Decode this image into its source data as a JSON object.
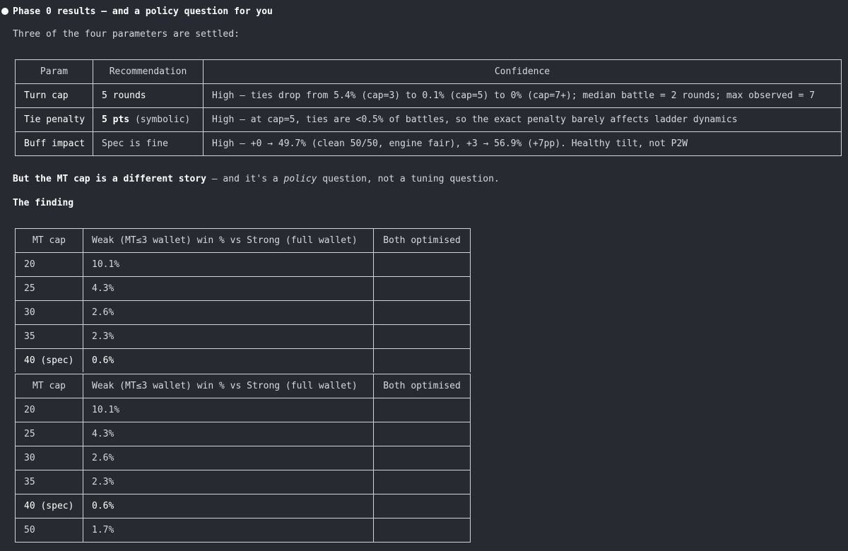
{
  "heading": "Phase 0 results — and a policy question for you",
  "intro": "Three of the four parameters are settled:",
  "params_table": {
    "headers": [
      "Param",
      "Recommendation",
      "Confidence"
    ],
    "rows": [
      {
        "param": "Turn cap",
        "rec": "5 rounds",
        "conf": "High — ties drop from 5.4% (cap=3) to 0.1% (cap=5) to 0% (cap=7+); median battle = 2 rounds; max observed = 7"
      },
      {
        "param": "Tie penalty",
        "rec": "5 pts (symbolic)",
        "conf": "High — at cap=5, ties are <0.5% of battles, so the exact penalty barely affects ladder dynamics"
      },
      {
        "param": "Buff impact",
        "rec": "Spec is fine",
        "conf": "High — +0 → 49.7% (clean 50/50, engine fair), +3 → 56.9% (+7pp). Healthy tilt, not P2W"
      }
    ]
  },
  "mt_sentence": {
    "bold": "But the MT cap is a different story",
    "pre": " — and it's a ",
    "italic": "policy",
    "post": " question, not a tuning question."
  },
  "finding_heading": "The finding",
  "mt_table": {
    "headers": [
      "MT cap",
      "Weak (MT≤3 wallet) win % vs Strong (full wallet)",
      "Both optimised"
    ],
    "rows_first": [
      {
        "cap": "20",
        "win": "10.1%",
        "both": ""
      },
      {
        "cap": "25",
        "win": "4.3%",
        "both": ""
      },
      {
        "cap": "30",
        "win": "2.6%",
        "both": ""
      },
      {
        "cap": "35",
        "win": "2.3%",
        "both": ""
      },
      {
        "cap": "40 (spec)",
        "win": "0.6%",
        "both": ""
      }
    ],
    "rows_second": [
      {
        "cap": "20",
        "win": "10.1%",
        "both": ""
      },
      {
        "cap": "25",
        "win": "4.3%",
        "both": ""
      },
      {
        "cap": "30",
        "win": "2.6%",
        "both": ""
      },
      {
        "cap": "35",
        "win": "2.3%",
        "both": ""
      },
      {
        "cap": "40 (spec)",
        "win": "0.6%",
        "both": ""
      },
      {
        "cap": "50",
        "win": "1.7%",
        "both": ""
      }
    ]
  }
}
